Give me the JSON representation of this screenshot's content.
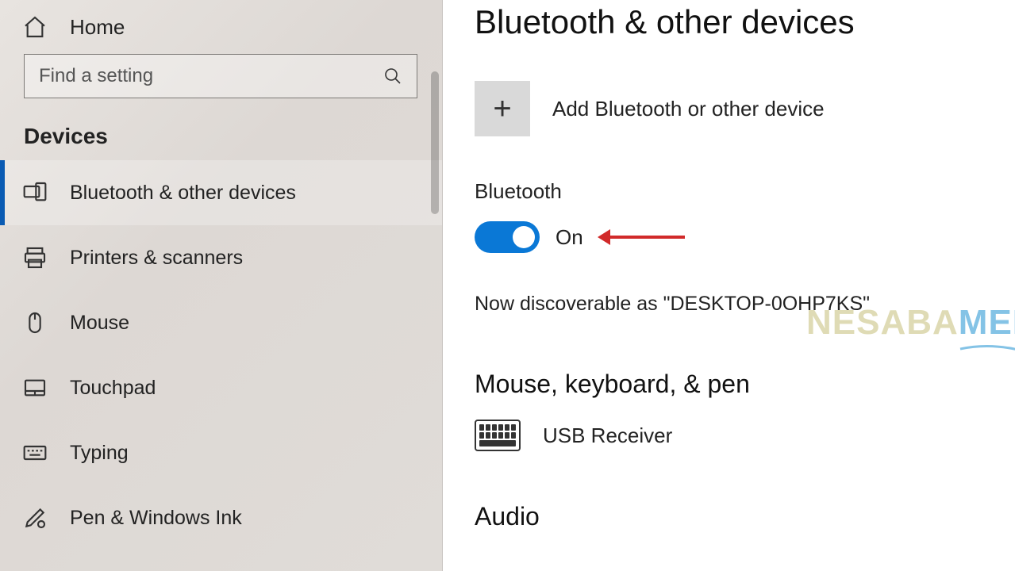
{
  "sidebar": {
    "home": "Home",
    "search_placeholder": "Find a setting",
    "section": "Devices",
    "items": [
      {
        "label": "Bluetooth & other devices"
      },
      {
        "label": "Printers & scanners"
      },
      {
        "label": "Mouse"
      },
      {
        "label": "Touchpad"
      },
      {
        "label": "Typing"
      },
      {
        "label": "Pen & Windows Ink"
      }
    ]
  },
  "main": {
    "title": "Bluetooth & other devices",
    "add_label": "Add Bluetooth or other device",
    "bt_heading": "Bluetooth",
    "toggle_state": "On",
    "discoverable": "Now discoverable as \"DESKTOP-0OHP7KS\"",
    "section_mkp": "Mouse, keyboard, & pen",
    "device1": "USB Receiver",
    "section_audio": "Audio"
  },
  "watermark": {
    "part1": "NESABA",
    "part2": "MEDIA"
  }
}
